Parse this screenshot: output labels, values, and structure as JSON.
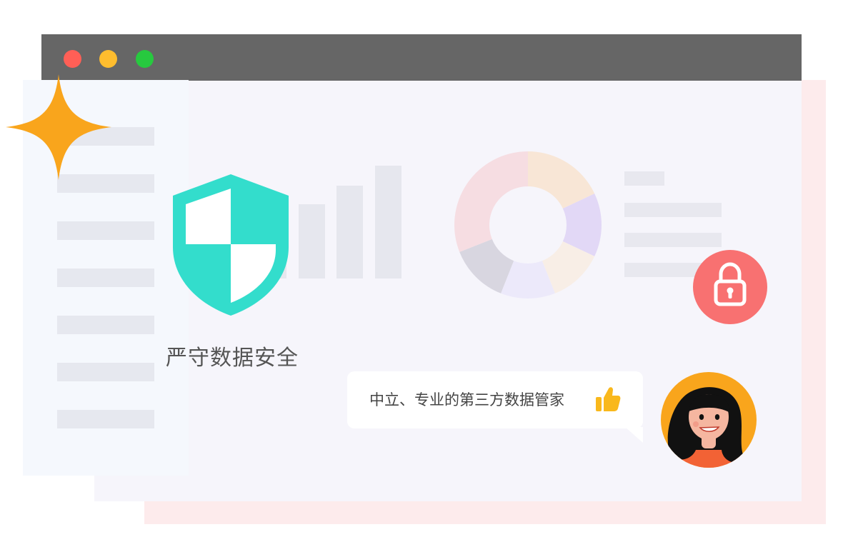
{
  "window": {
    "controls": [
      {
        "name": "close",
        "color": "#ff5f56"
      },
      {
        "name": "minimize",
        "color": "#ffbd2e"
      },
      {
        "name": "maximize",
        "color": "#27c93f"
      }
    ]
  },
  "hero": {
    "headline": "严守数据安全"
  },
  "bubble": {
    "message": "中立、专业的第三方数据管家"
  },
  "colors": {
    "shield": "#33ddcc",
    "lock_badge": "#f87171",
    "sparkle": "#f9a51c",
    "avatar_bg": "#f9a51c",
    "thumb": "#f9b81c"
  },
  "chart_data": {
    "type": "pie",
    "donut": true,
    "slices": [
      {
        "value": 18,
        "color": "#f8e6d6"
      },
      {
        "value": 14,
        "color": "#e2d8f6"
      },
      {
        "value": 12,
        "color": "#f8eee6"
      },
      {
        "value": 12,
        "color": "#ece9fa"
      },
      {
        "value": 13,
        "color": "#d8d6e0"
      },
      {
        "value": 31,
        "color": "#f6dde2"
      }
    ]
  }
}
